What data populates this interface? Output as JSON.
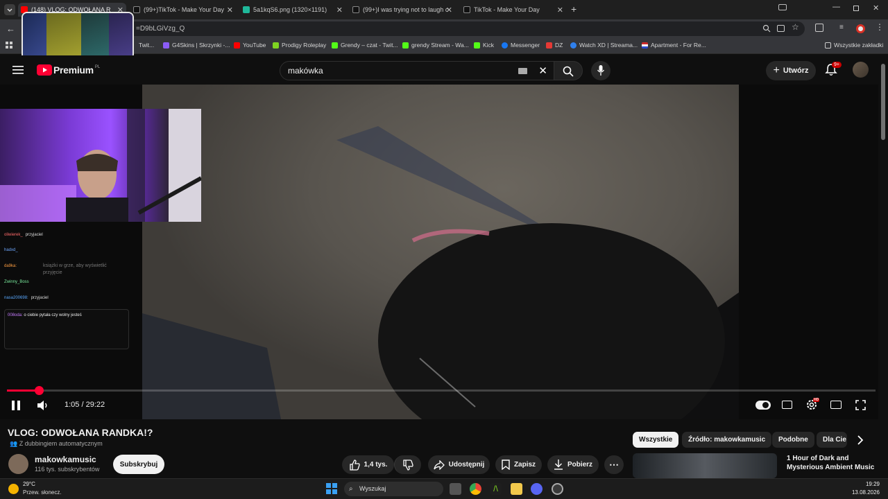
{
  "browser": {
    "tabs": [
      {
        "label": "(148) VLOG: ODWOŁANA R",
        "active": true,
        "color": "#ff0000"
      },
      {
        "label": "(99+)TikTok - Make Your Day",
        "color": "#ffffff"
      },
      {
        "label": "5a1kqS6.png (1320×1191)",
        "color": "#1fb89a"
      },
      {
        "label": "(99+)I was trying not to laugh c",
        "color": "#ffffff"
      },
      {
        "label": "TikTok - Make Your Day",
        "color": "#ffffff"
      }
    ],
    "url": "=D9bLGiVzg_Q",
    "bookmarks": [
      {
        "label": "Twit...",
        "color": "#9146ff"
      },
      {
        "label": "G4Skins | Skrzynki -...",
        "color": "#8b5cf6"
      },
      {
        "label": "YouTube",
        "color": "#ff0000"
      },
      {
        "label": "Prodigy Roleplay",
        "color": "#7ed321"
      },
      {
        "label": "Grendy – czat - Twit...",
        "color": "#53fc18"
      },
      {
        "label": "grendy Stream - Wa...",
        "color": "#53fc18"
      },
      {
        "label": "Kick",
        "color": "#53fc18"
      },
      {
        "label": "Messenger",
        "color": "#1877f2"
      },
      {
        "label": "DZ",
        "color": "#e53935"
      },
      {
        "label": "Watch XD | Streama...",
        "color": "#2f80ed"
      },
      {
        "label": "Apartment - For Re...",
        "color": "#cc2b2b"
      }
    ],
    "all_bookmarks": "Wszystkie zakładki"
  },
  "youtube": {
    "logo_text": "Premium",
    "logo_sup": "PL",
    "search_value": "makówka",
    "create_label": "Utwórz",
    "notif_badge": "9+"
  },
  "player": {
    "current_time": "1:05",
    "duration": "29:22",
    "time_display": "1:05 / 29:22",
    "progress_fraction": 0.037,
    "hd_badge": "HD",
    "chat": [
      {
        "user": "oliwierek_",
        "msg": "przyjaciel",
        "color": "#ff6b6b"
      },
      {
        "user": "hadxd_",
        "msg": "",
        "color": "#6fa8ff"
      },
      {
        "user": "da9ka:",
        "msg": "",
        "color": "#ff9f43"
      },
      {
        "user": "Zwinny_Boss",
        "msg": "",
        "color": "#7bed9f"
      },
      {
        "user": "nasa200698:",
        "msg": "przyjaciel",
        "color": "#5aa9ff"
      },
      {
        "user": "008oda:",
        "msg": "o ciebie pytała czy wolny jesteś",
        "color": "#c77dff"
      }
    ],
    "faded_text": "książki w grze, aby wyświetlić przyjęcie"
  },
  "video": {
    "title": "VLOG: ODWOŁANA RANDKA!?",
    "dubbing": "Z dubbingiem automatycznym",
    "channel": "makowkamusic",
    "subscribers": "116 tys. subskrybentów",
    "subscribe_label": "Subskrybuj",
    "likes": "1,4 tys.",
    "share_label": "Udostępnij",
    "save_label": "Zapisz",
    "download_label": "Pobierz"
  },
  "chips": [
    "Wszystkie",
    "Źródło: makowkamusic",
    "Podobne",
    "Dla Cie"
  ],
  "recommendation": {
    "title": "1 Hour of Dark and Mysterious Ambient Music"
  },
  "taskbar": {
    "temp": "29°C",
    "weather": "Przew. słonecz.",
    "search_placeholder": "Wyszukaj",
    "time": "19:29",
    "date": "13.08.2026"
  }
}
